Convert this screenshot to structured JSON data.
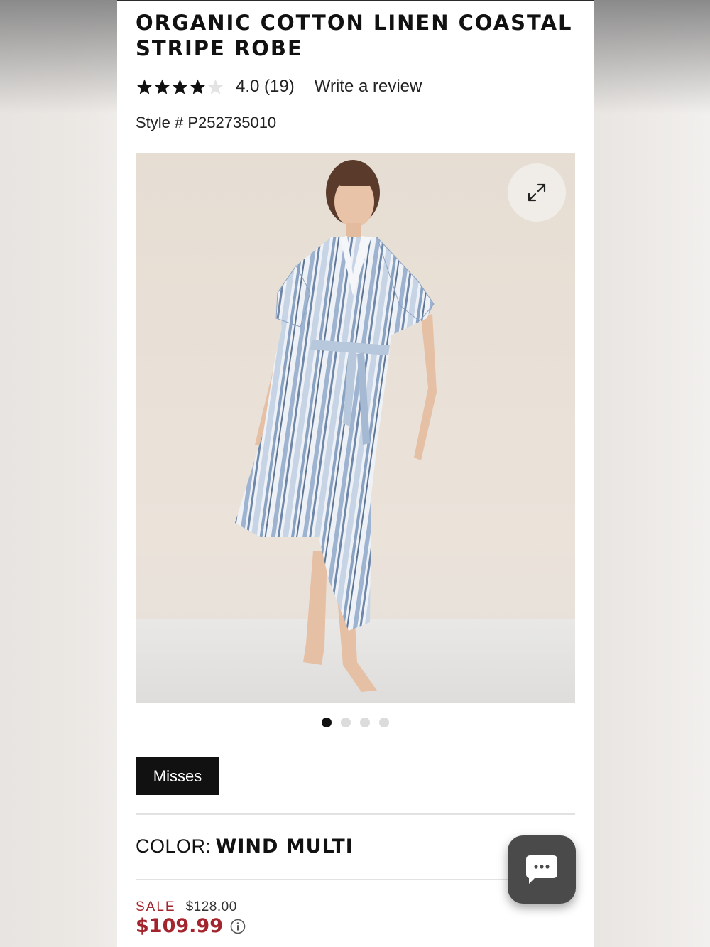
{
  "product": {
    "title": "ORGANIC COTTON LINEN COASTAL STRIPE ROBE",
    "rating_value": 4.0,
    "rating_max": 5,
    "rating_text": "4.0",
    "review_count": "(19)",
    "write_review_label": "Write a review",
    "style_number": "Style # P252735010"
  },
  "gallery": {
    "image_description_icon": "product-photo",
    "expand_icon": "expand-icon",
    "total_images": 4,
    "active_index": 0
  },
  "sizes": {
    "selected_label": "Misses"
  },
  "color": {
    "label": "COLOR:",
    "value": "WIND MULTI"
  },
  "pricing": {
    "sale_label": "SALE",
    "original_price": "$128.00",
    "sale_price": "$109.99",
    "info_icon": "info-icon"
  },
  "chat": {
    "icon": "chat-bubble-icon"
  },
  "colors": {
    "sale_red": "#a3242c",
    "text_dark": "#111111",
    "chat_bg": "#4a4a4a"
  }
}
